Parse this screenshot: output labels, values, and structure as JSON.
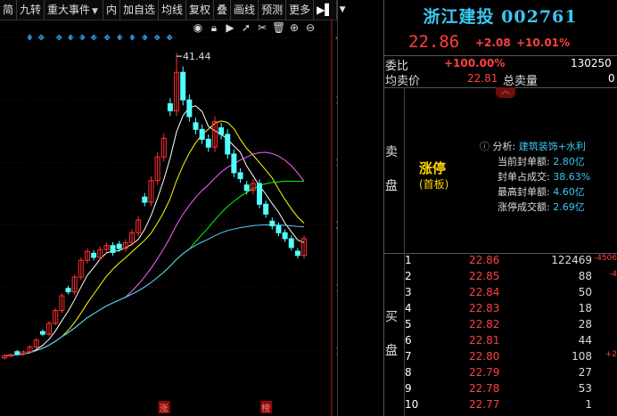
{
  "toolbar": {
    "items": [
      "简",
      "九转",
      "重大事件",
      "内",
      "加自选",
      "均线",
      "复权",
      "叠",
      "画线",
      "预测",
      "更多"
    ]
  },
  "icons": [
    "eye-icon",
    "lock-icon",
    "play-icon",
    "cursor-icon",
    "scissors-icon",
    "trash-icon",
    "add-icon",
    "remove-icon"
  ],
  "chart": {
    "y_axis": [
      "43.35",
      "37.03",
      "30.62",
      "24.31",
      "17.90",
      "11.49"
    ],
    "high_label": "41.44",
    "bottom_tags": [
      "涨",
      "榜"
    ],
    "colors": {
      "up": "#ff3030",
      "down": "#54ffff",
      "ma5": "#ffffff",
      "ma10": "#ffff00",
      "ma20": "#ff60ff",
      "ma30": "#00ff00",
      "ma60": "#5ac8ff"
    }
  },
  "stock": {
    "name": "浙江建投",
    "code": "002761",
    "price": "22.86",
    "change": "+2.08",
    "pct": "+10.01%"
  },
  "commission": {
    "label_ratio": "委比",
    "ratio": "+100.00%",
    "ratio_vol": "130250",
    "label_avg": "均卖价",
    "avg": "22.81",
    "label_total": "总卖量",
    "total": "0"
  },
  "limit_status": {
    "side_sell": [
      "卖",
      "盘"
    ],
    "side_buy": [
      "买",
      "盘"
    ],
    "status": "涨停",
    "sub": "(首板)"
  },
  "analysis": {
    "label": "分析:",
    "sector": "建筑装饰+水利",
    "rows": [
      {
        "k": "当前封单额:",
        "v": "2.80亿"
      },
      {
        "k": "封单占成交:",
        "v": "38.63%"
      },
      {
        "k": "最高封单额:",
        "v": "4.60亿"
      },
      {
        "k": "涨停成交额:",
        "v": "2.69亿"
      }
    ]
  },
  "orderbook": [
    {
      "i": "1",
      "p": "22.86",
      "q": "122469",
      "d": "-4506"
    },
    {
      "i": "2",
      "p": "22.85",
      "q": "88",
      "d": "-4"
    },
    {
      "i": "3",
      "p": "22.84",
      "q": "50",
      "d": ""
    },
    {
      "i": "4",
      "p": "22.83",
      "q": "18",
      "d": ""
    },
    {
      "i": "5",
      "p": "22.82",
      "q": "28",
      "d": ""
    },
    {
      "i": "6",
      "p": "22.81",
      "q": "44",
      "d": ""
    },
    {
      "i": "7",
      "p": "22.80",
      "q": "108",
      "d": "+2"
    },
    {
      "i": "8",
      "p": "22.79",
      "q": "27",
      "d": ""
    },
    {
      "i": "9",
      "p": "22.78",
      "q": "53",
      "d": ""
    },
    {
      "i": "10",
      "p": "22.77",
      "q": "1",
      "d": ""
    }
  ]
}
